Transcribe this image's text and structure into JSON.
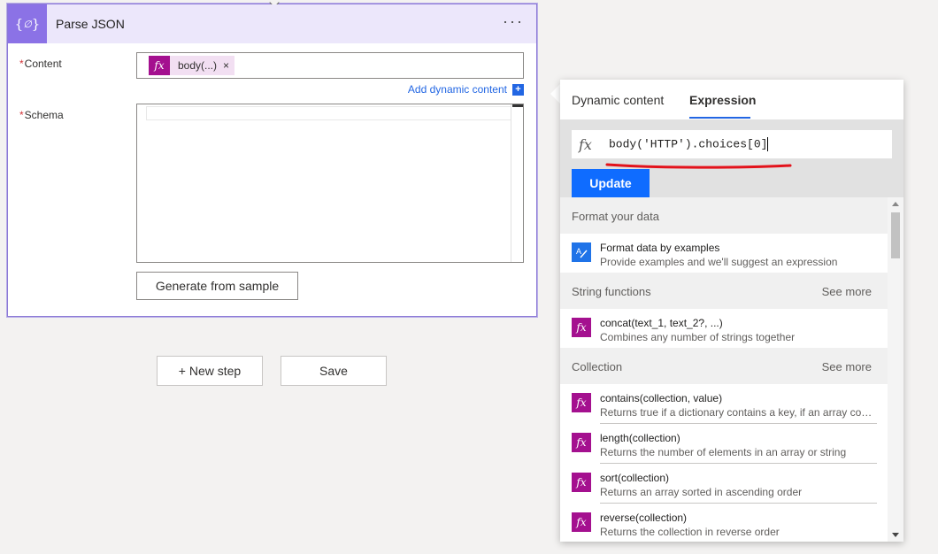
{
  "card": {
    "title": "Parse JSON",
    "icon": "json-braces-icon",
    "more_label": "···",
    "content_label": "Content",
    "schema_label": "Schema",
    "required_mark": "*",
    "content_token": {
      "fx": "fx",
      "text": "body(...)",
      "remove": "×"
    },
    "add_dynamic_label": "Add dynamic content",
    "add_dynamic_plus": "+",
    "generate_label": "Generate from sample"
  },
  "steps": {
    "new_step_label": "+ New step",
    "save_label": "Save"
  },
  "panel": {
    "tabs": [
      {
        "label": "Dynamic content",
        "active": false
      },
      {
        "label": "Expression",
        "active": true
      }
    ],
    "expression_fx": "fx",
    "expression_value": "body('HTTP').choices[0]",
    "update_label": "Update",
    "sections": [
      {
        "title": "Format your data",
        "see_more": "",
        "items": [
          {
            "name": "Format data by examples",
            "desc": "Provide examples and we'll suggest an expression",
            "icon": "format-data-icon"
          }
        ]
      },
      {
        "title": "String functions",
        "see_more": "See more",
        "items": [
          {
            "name": "concat(text_1, text_2?, ...)",
            "desc": "Combines any number of strings together",
            "icon": "fx-icon"
          }
        ]
      },
      {
        "title": "Collection",
        "see_more": "See more",
        "items": [
          {
            "name": "contains(collection, value)",
            "desc": "Returns true if a dictionary contains a key, if an array contains a value",
            "icon": "fx-icon"
          },
          {
            "name": "length(collection)",
            "desc": "Returns the number of elements in an array or string",
            "icon": "fx-icon"
          },
          {
            "name": "sort(collection)",
            "desc": "Returns an array sorted in ascending order",
            "icon": "fx-icon"
          },
          {
            "name": "reverse(collection)",
            "desc": "Returns the collection in reverse order",
            "icon": "fx-icon"
          }
        ]
      }
    ]
  },
  "colors": {
    "accent": "#8b72e6",
    "fx_token": "#a4108f",
    "link": "#2266e3",
    "update_button": "#0f6cff",
    "annotation": "#e3121b"
  }
}
